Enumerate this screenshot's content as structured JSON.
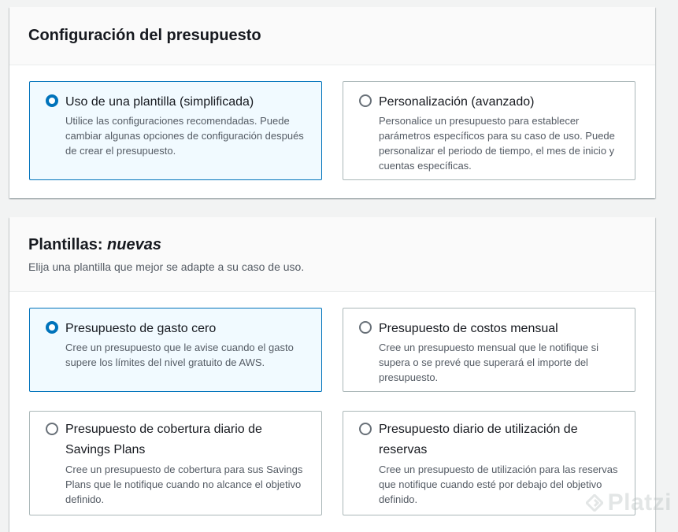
{
  "budget_setup": {
    "title": "Configuración del presupuesto",
    "options": [
      {
        "title": "Uso de una plantilla (simplificada)",
        "description": "Utilice las configuraciones recomendadas. Puede cambiar algunas opciones de configuración después de crear el presupuesto.",
        "selected": true
      },
      {
        "title": "Personalización (avanzado)",
        "description": "Personalice un presupuesto para establecer parámetros específicos para su caso de uso. Puede personalizar el periodo de tiempo, el mes de inicio y cuentas específicas.",
        "selected": false
      }
    ]
  },
  "templates": {
    "title": "Plantillas: ",
    "title_emphasis": "nuevas",
    "description": "Elija una plantilla que mejor se adapte a su caso de uso.",
    "options": [
      {
        "title": "Presupuesto de gasto cero",
        "description": "Cree un presupuesto que le avise cuando el gasto supere los límites del nivel gratuito de AWS.",
        "selected": true
      },
      {
        "title": "Presupuesto de costos mensual",
        "description": "Cree un presupuesto mensual que le notifique si supera o se prevé que superará el importe del presupuesto.",
        "selected": false
      },
      {
        "title": "Presupuesto de cobertura diario de Savings Plans",
        "description": "Cree un presupuesto de cobertura para sus Savings Plans que le notifique cuando no alcance el objetivo definido.",
        "selected": false
      },
      {
        "title": "Presupuesto diario de utilización de reservas",
        "description": "Cree un presupuesto de utilización para las reservas que notifique cuando esté por debajo del objetivo definido.",
        "selected": false
      }
    ]
  },
  "watermark": {
    "text": "Platzi"
  },
  "colors": {
    "selected_border": "#0073bb",
    "selected_background": "#f1faff",
    "tile_border": "#aab7b8"
  }
}
